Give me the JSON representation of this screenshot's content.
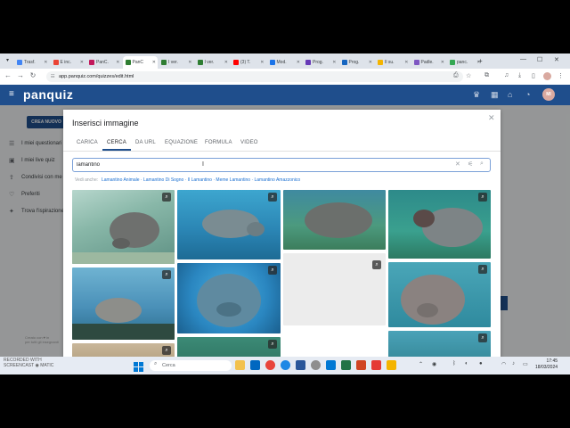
{
  "browser": {
    "tabs": [
      {
        "label": "Trasf.",
        "color": "#4285f4"
      },
      {
        "label": "E inc.",
        "color": "#ea4335"
      },
      {
        "label": "PanC.",
        "color": "#c2185b"
      },
      {
        "label": "PanC",
        "color": "#2e7d32",
        "active": true
      },
      {
        "label": "I ver.",
        "color": "#2e7d32"
      },
      {
        "label": "I ver.",
        "color": "#2e7d32"
      },
      {
        "label": "(3) T.",
        "color": "#ff0000"
      },
      {
        "label": "Mod.",
        "color": "#1a73e8"
      },
      {
        "label": "Prog.",
        "color": "#673ab7"
      },
      {
        "label": "Prog.",
        "color": "#1565c0"
      },
      {
        "label": "Il su.",
        "color": "#f4b400"
      },
      {
        "label": "Padle.",
        "color": "#7e57c2"
      },
      {
        "label": "panc.",
        "color": "#34a853"
      }
    ],
    "url": "app.panquiz.com/quizzes/edit.html"
  },
  "app": {
    "logo": "panquiz",
    "create_button": "CREA NUOVO",
    "sidebar": [
      {
        "label": "I miei questionari",
        "icon": "list-icon"
      },
      {
        "label": "I miei live quiz",
        "icon": "live-icon"
      },
      {
        "label": "Condivisi con me",
        "icon": "share-icon"
      },
      {
        "label": "Preferiti",
        "icon": "heart-icon"
      },
      {
        "label": "Trova l'ispirazione",
        "icon": "bulb-icon"
      }
    ],
    "footer_credit": [
      "Creato con ♥ in",
      "per tutti gli insegnanti"
    ],
    "avatar_initials": "MI"
  },
  "dialog": {
    "title": "Inserisci immagine",
    "tabs": [
      "CARICA",
      "CERCA",
      "DA URL",
      "EQUAZIONE",
      "FORMULA",
      "VIDEO"
    ],
    "active_tab": "CERCA",
    "search_value": "lamantino",
    "suggest_label": "Vedi anche:",
    "suggestions": "Lamantino Animale · Lamantino Di Sogno · Il Lamantino · Meme Lamantino · Lamantino Amazzonico"
  },
  "taskbar": {
    "watermark": [
      "RECORDED WITH",
      "SCREENCAST ◉ MATIC"
    ],
    "search_placeholder": "Cerca",
    "time": "17:45",
    "date": "18/03/2024"
  }
}
